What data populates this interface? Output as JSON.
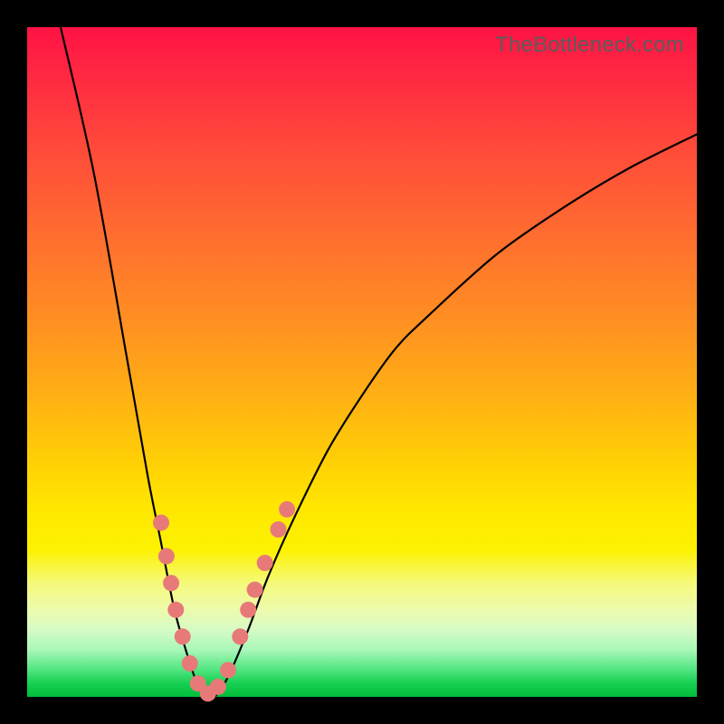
{
  "watermark": "TheBottleneck.com",
  "chart_data": {
    "type": "line",
    "title": "",
    "xlabel": "",
    "ylabel": "",
    "xlim": [
      0,
      100
    ],
    "ylim": [
      0,
      100
    ],
    "grid": false,
    "legend": false,
    "series": [
      {
        "name": "bottleneck-curve",
        "x": [
          5,
          10,
          15,
          18,
          20,
          22,
          24,
          25,
          26,
          27,
          28,
          30,
          33,
          36,
          40,
          45,
          50,
          55,
          60,
          70,
          80,
          90,
          100
        ],
        "y": [
          100,
          78,
          50,
          33,
          23,
          13,
          6,
          3,
          1,
          0,
          0,
          3,
          10,
          18,
          27,
          37,
          45,
          52,
          57,
          66,
          73,
          79,
          84
        ]
      }
    ],
    "markers": {
      "name": "highlight-points",
      "color": "#e77a78",
      "points": [
        {
          "x": 20.0,
          "y": 26
        },
        {
          "x": 20.8,
          "y": 21
        },
        {
          "x": 21.5,
          "y": 17
        },
        {
          "x": 22.2,
          "y": 13
        },
        {
          "x": 23.2,
          "y": 9
        },
        {
          "x": 24.3,
          "y": 5
        },
        {
          "x": 25.5,
          "y": 2
        },
        {
          "x": 27.0,
          "y": 0.5
        },
        {
          "x": 28.5,
          "y": 1.5
        },
        {
          "x": 30.0,
          "y": 4
        },
        {
          "x": 31.8,
          "y": 9
        },
        {
          "x": 33.0,
          "y": 13
        },
        {
          "x": 34.0,
          "y": 16
        },
        {
          "x": 35.5,
          "y": 20
        },
        {
          "x": 37.5,
          "y": 25
        },
        {
          "x": 38.8,
          "y": 28
        }
      ]
    },
    "background": {
      "type": "vertical-gradient",
      "stops": [
        {
          "pos": 0,
          "color": "#ff1345"
        },
        {
          "pos": 50,
          "color": "#ffb800"
        },
        {
          "pos": 80,
          "color": "#f6f900"
        },
        {
          "pos": 100,
          "color": "#00bd39"
        }
      ]
    }
  }
}
